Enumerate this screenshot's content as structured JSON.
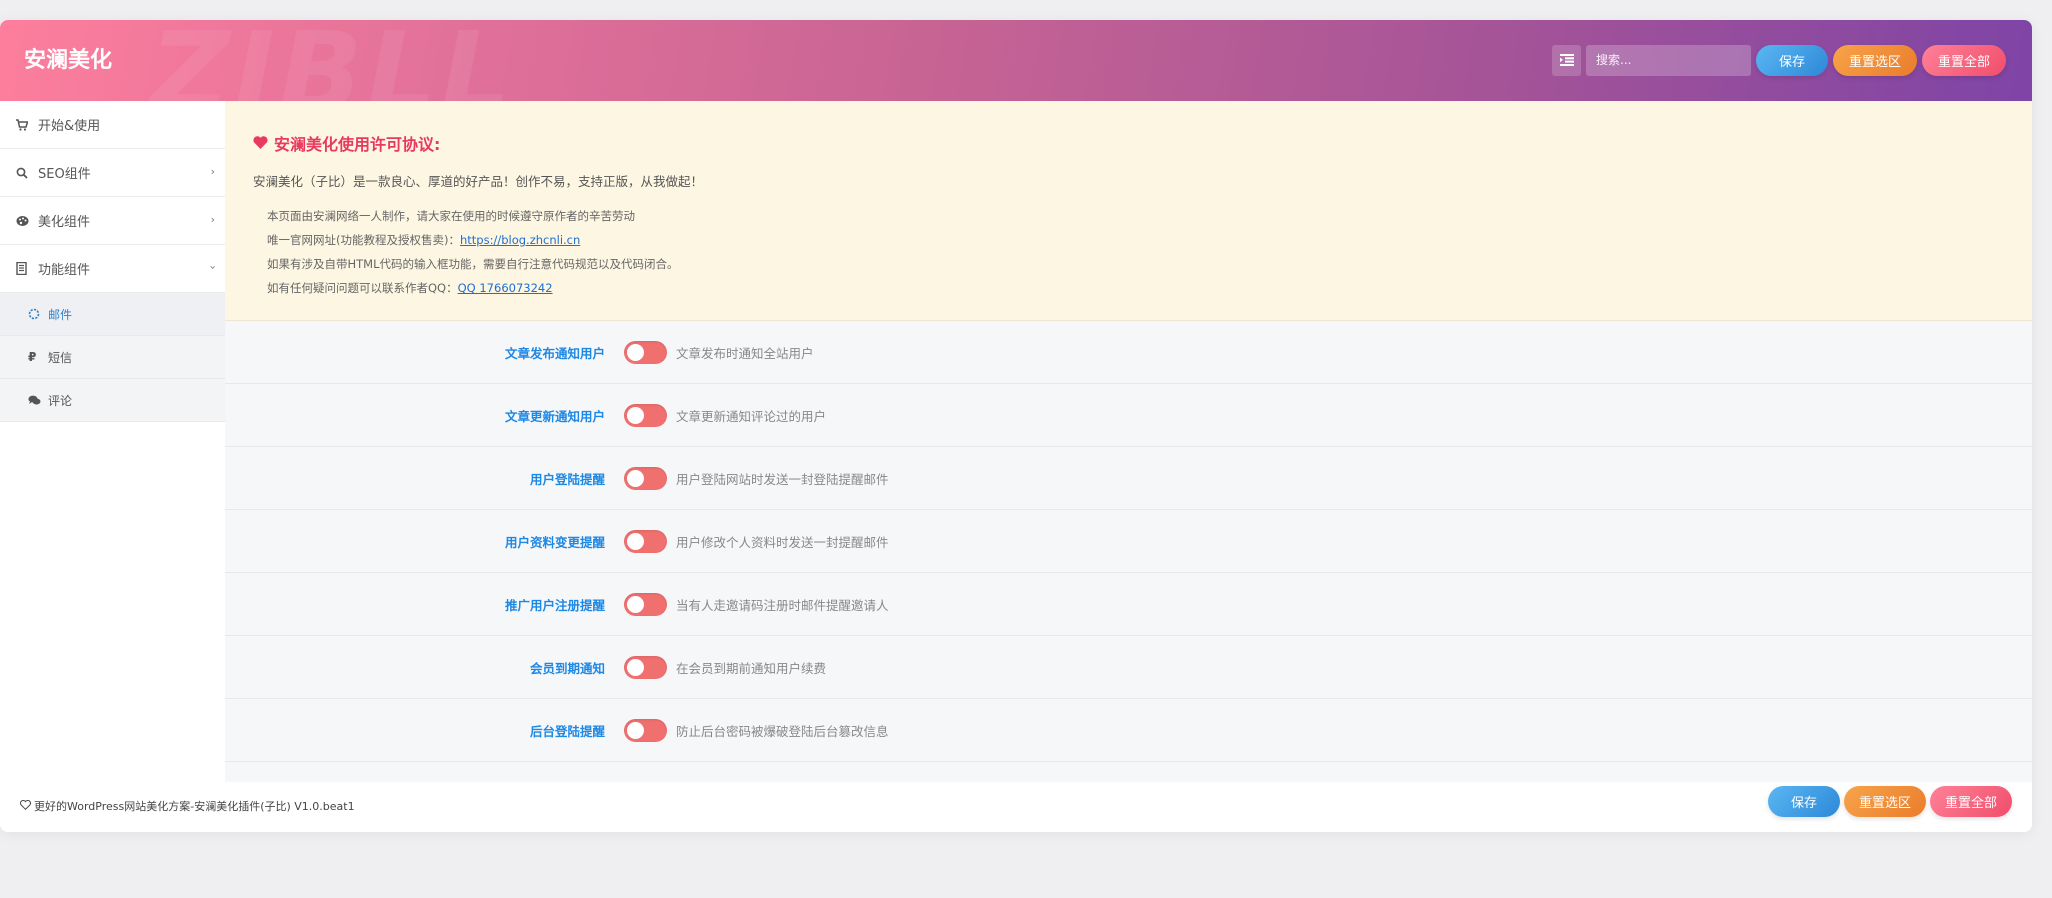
{
  "header": {
    "brand": "安澜美化",
    "watermark": "ZIBLL",
    "search_placeholder": "搜索...",
    "save_label": "保存",
    "reset_section_label": "重置选区",
    "reset_all_label": "重置全部"
  },
  "sidebar": {
    "items": [
      {
        "label": "开始&使用",
        "icon": "cart-icon"
      },
      {
        "label": "SEO组件",
        "icon": "search-icon"
      },
      {
        "label": "美化组件",
        "icon": "palette-icon"
      },
      {
        "label": "功能组件",
        "icon": "book-icon"
      }
    ],
    "sub_items": [
      {
        "label": "邮件",
        "icon": "spinner-icon"
      },
      {
        "label": "短信",
        "icon": "ruble-icon"
      },
      {
        "label": "评论",
        "icon": "comments-icon"
      }
    ]
  },
  "notice": {
    "title": "安澜美化使用许可协议:",
    "lead": "安澜美化（子比）是一款良心、厚道的好产品！创作不易，支持正版，从我做起！",
    "line1": "本页面由安澜网络一人制作，请大家在使用的时候遵守原作者的辛苦劳动",
    "line2_prefix": "唯一官网网址(功能教程及授权售卖)：",
    "line2_link": "https://blog.zhcnli.cn",
    "line3": "如果有涉及自带HTML代码的输入框功能，需要自行注意代码规范以及代码闭合。",
    "line4_prefix": "如有任何疑问问题可以联系作者QQ：",
    "line4_link": "QQ 1766073242"
  },
  "options": [
    {
      "label": "文章发布通知用户",
      "desc": "文章发布时通知全站用户",
      "enabled": false
    },
    {
      "label": "文章更新通知用户",
      "desc": "文章更新通知评论过的用户",
      "enabled": false
    },
    {
      "label": "用户登陆提醒",
      "desc": "用户登陆网站时发送一封登陆提醒邮件",
      "enabled": false
    },
    {
      "label": "用户资料变更提醒",
      "desc": "用户修改个人资料时发送一封提醒邮件",
      "enabled": false
    },
    {
      "label": "推广用户注册提醒",
      "desc": "当有人走邀请码注册时邮件提醒邀请人",
      "enabled": false
    },
    {
      "label": "会员到期通知",
      "desc": "在会员到期前通知用户续费",
      "enabled": false
    },
    {
      "label": "后台登陆提醒",
      "desc": "防止后台密码被爆破登陆后台篡改信息",
      "enabled": false
    }
  ],
  "footer": {
    "text": "更好的WordPress网站美化方案-安澜美化插件(子比) V1.0.beat1",
    "save_label": "保存",
    "reset_section_label": "重置选区",
    "reset_all_label": "重置全部"
  },
  "colors": {
    "accent_blue": "#1e88e5",
    "toggle_off": "#f07070",
    "notice_title": "#e8395f"
  }
}
